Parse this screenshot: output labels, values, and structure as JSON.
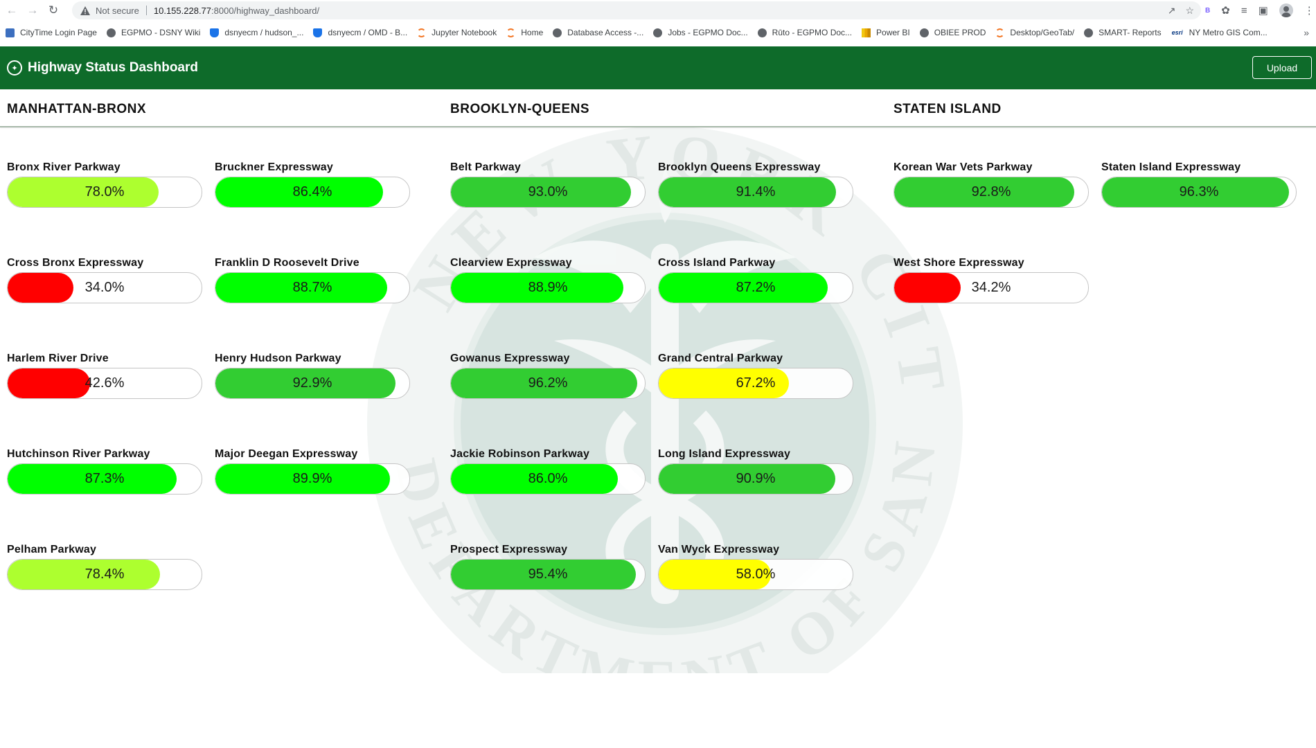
{
  "browser": {
    "security_label": "Not secure",
    "url_host": "10.155.228.77",
    "url_path": ":8000/highway_dashboard/",
    "bookmarks": [
      {
        "label": "CityTime Login Page",
        "icon": "city-icon"
      },
      {
        "label": "EGPMO - DSNY Wiki",
        "icon": "globe-icon"
      },
      {
        "label": "dsnyecm / hudson_...",
        "icon": "shield-icon"
      },
      {
        "label": "dsnyecm / OMD - B...",
        "icon": "shield-icon"
      },
      {
        "label": "Jupyter Notebook",
        "icon": "jupyter-icon"
      },
      {
        "label": "Home",
        "icon": "jupyter-icon"
      },
      {
        "label": "Database Access -...",
        "icon": "globe-icon"
      },
      {
        "label": "Jobs - EGPMO Doc...",
        "icon": "globe-icon"
      },
      {
        "label": "Rūto - EGPMO Doc...",
        "icon": "globe-icon"
      },
      {
        "label": "Power BI",
        "icon": "powerbi-icon"
      },
      {
        "label": "OBIEE PROD",
        "icon": "globe-icon"
      },
      {
        "label": "Desktop/GeoTab/",
        "icon": "jupyter-icon"
      },
      {
        "label": "SMART- Reports",
        "icon": "globe-icon"
      },
      {
        "label": "NY Metro GIS Com...",
        "icon": "esri-icon"
      }
    ],
    "esri_text": "esri"
  },
  "header": {
    "title": "Highway Status Dashboard",
    "upload_label": "Upload"
  },
  "colors": {
    "header_green": "#0e6b2a",
    "red": "#ff0000",
    "yellow": "#ffff00",
    "yellow_green": "#adff2f",
    "lime": "#00ff00",
    "green": "#32cd32"
  },
  "regions": [
    {
      "name": "MANHATTAN-BRONX",
      "highways": [
        {
          "name": "Bronx River Parkway",
          "value": 78.0,
          "display": "78.0%",
          "color": "#adff2f"
        },
        {
          "name": "Bruckner Expressway",
          "value": 86.4,
          "display": "86.4%",
          "color": "#00ff00"
        },
        {
          "name": "Cross Bronx Expressway",
          "value": 34.0,
          "display": "34.0%",
          "color": "#ff0000"
        },
        {
          "name": "Franklin D Roosevelt Drive",
          "value": 88.7,
          "display": "88.7%",
          "color": "#00ff00"
        },
        {
          "name": "Harlem River Drive",
          "value": 42.6,
          "display": "42.6%",
          "color": "#ff0000"
        },
        {
          "name": "Henry Hudson Parkway",
          "value": 92.9,
          "display": "92.9%",
          "color": "#32cd32"
        },
        {
          "name": "Hutchinson River Parkway",
          "value": 87.3,
          "display": "87.3%",
          "color": "#00ff00"
        },
        {
          "name": "Major Deegan Expressway",
          "value": 89.9,
          "display": "89.9%",
          "color": "#00ff00"
        },
        {
          "name": "Pelham Parkway",
          "value": 78.4,
          "display": "78.4%",
          "color": "#adff2f"
        }
      ]
    },
    {
      "name": "BROOKLYN-QUEENS",
      "highways": [
        {
          "name": "Belt Parkway",
          "value": 93.0,
          "display": "93.0%",
          "color": "#32cd32"
        },
        {
          "name": "Brooklyn Queens Expressway",
          "value": 91.4,
          "display": "91.4%",
          "color": "#32cd32"
        },
        {
          "name": "Clearview Expressway",
          "value": 88.9,
          "display": "88.9%",
          "color": "#00ff00"
        },
        {
          "name": "Cross Island Parkway",
          "value": 87.2,
          "display": "87.2%",
          "color": "#00ff00"
        },
        {
          "name": "Gowanus Expressway",
          "value": 96.2,
          "display": "96.2%",
          "color": "#32cd32"
        },
        {
          "name": "Grand Central Parkway",
          "value": 67.2,
          "display": "67.2%",
          "color": "#ffff00"
        },
        {
          "name": "Jackie Robinson Parkway",
          "value": 86.0,
          "display": "86.0%",
          "color": "#00ff00"
        },
        {
          "name": "Long Island Expressway",
          "value": 90.9,
          "display": "90.9%",
          "color": "#32cd32"
        },
        {
          "name": "Prospect Expressway",
          "value": 95.4,
          "display": "95.4%",
          "color": "#32cd32"
        },
        {
          "name": "Van Wyck Expressway",
          "value": 58.0,
          "display": "58.0%",
          "color": "#ffff00"
        }
      ]
    },
    {
      "name": "STATEN ISLAND",
      "highways": [
        {
          "name": "Korean War Vets Parkway",
          "value": 92.8,
          "display": "92.8%",
          "color": "#32cd32"
        },
        {
          "name": "Staten Island Expressway",
          "value": 96.3,
          "display": "96.3%",
          "color": "#32cd32"
        },
        {
          "name": "West Shore Expressway",
          "value": 34.2,
          "display": "34.2%",
          "color": "#ff0000"
        }
      ]
    }
  ]
}
